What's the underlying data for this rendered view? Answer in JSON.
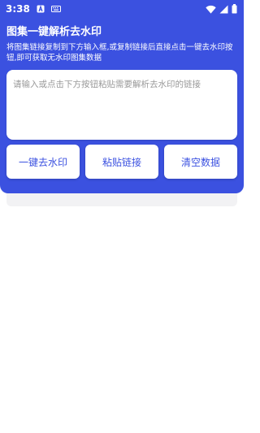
{
  "status_bar": {
    "time": "3:38",
    "left_icons": [
      "a-notification-icon",
      "keyboard-icon"
    ],
    "right_icons": [
      "wifi-icon",
      "cellular-signal-icon",
      "battery-icon"
    ]
  },
  "header": {
    "title": "图集一键解析去水印",
    "description": "将图集链接复制到下方输入框,或复制链接后直接点击一键去水印按钮,即可获取无水印图集数据"
  },
  "input": {
    "value": "",
    "placeholder": "请输入或点击下方按钮粘贴需要解析去水印的链接"
  },
  "buttons": {
    "remove_watermark": "一键去水印",
    "paste_link": "粘贴链接",
    "clear_data": "清空数据"
  },
  "colors": {
    "accent": "#3b51e0",
    "result_bg": "#f2f2f4"
  }
}
